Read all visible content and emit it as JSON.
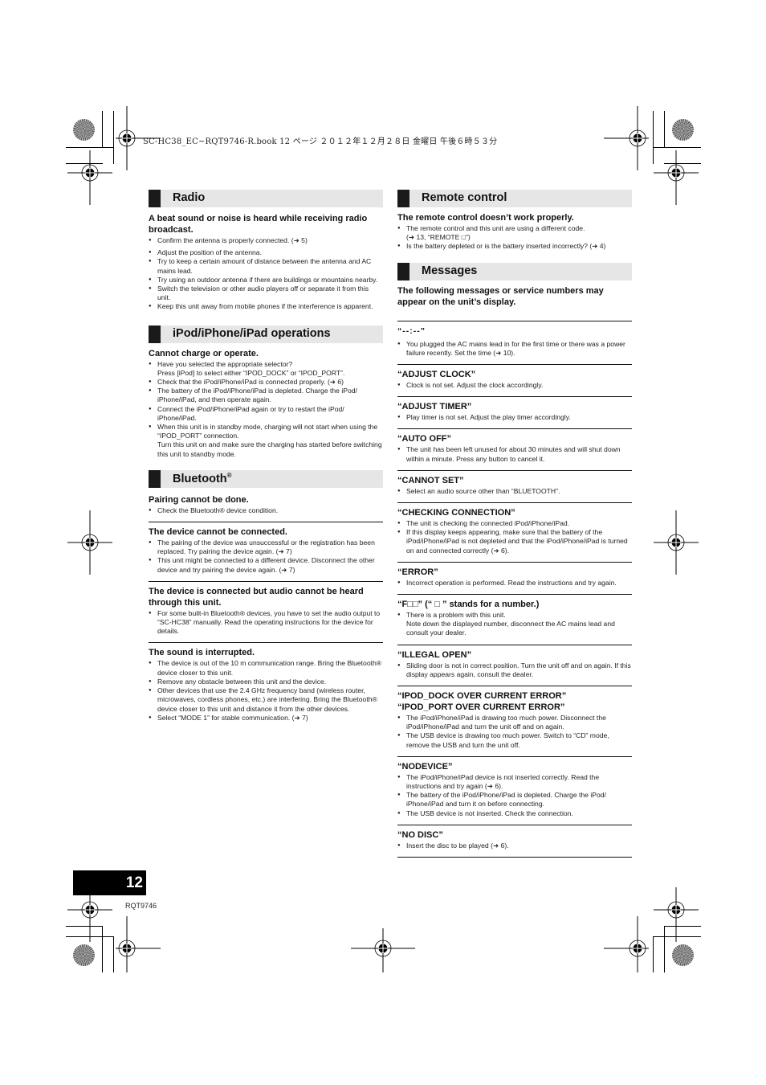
{
  "print_slug": "SC-HC38_EC~RQT9746-R.book  12 ページ  ２０１２年１２月２８日  金曜日  午後６時５３分",
  "left_column": {
    "sections": [
      {
        "title": "Radio",
        "blocks": [
          {
            "question": "A beat sound or noise is heard while receiving radio broadcast.",
            "items": [
              "Confirm the antenna is properly connected. (➜ 5)",
              "Adjust the position of the antenna.",
              "Try to keep a certain amount of distance between the antenna and AC mains lead.",
              "Try using an outdoor antenna if there are buildings or mountains nearby.",
              "Switch the television or other audio players off or separate it from this unit.",
              "Keep this unit away from mobile phones if the interference is apparent."
            ]
          }
        ]
      },
      {
        "title": "iPod/iPhone/iPad operations",
        "blocks": [
          {
            "question": "Cannot charge or operate.",
            "items": [
              "Have you selected the appropriate selector?",
              "Press [iPod] to select either “IPOD_DOCK” or “IPOD_PORT”.",
              "Check that the iPod/iPhone/iPad is connected properly. (➜ 6)",
              "The battery of the iPod/iPhone/iPad is depleted. Charge the iPod/ iPhone/iPad, and then operate again.",
              "Connect the iPod/iPhone/iPad again or try to restart the iPod/ iPhone/iPad.",
              "When this unit is in standby mode, charging will not start when using the “IPOD_PORT” connection.",
              "Turn this unit on and make sure the charging has started before switching this unit to standby mode."
            ]
          }
        ]
      },
      {
        "title": "Bluetooth",
        "title_sup": "®",
        "blocks": [
          {
            "question": "Pairing cannot be done.",
            "items": [
              "Check the Bluetooth® device condition."
            ]
          },
          {
            "question": "The device cannot be connected.",
            "items": [
              "The pairing of the device was unsuccessful or the registration has been replaced. Try pairing the device again. (➜ 7)",
              "This unit might be connected to a different device. Disconnect the other device and try pairing the device again. (➜ 7)"
            ]
          },
          {
            "question": "The device is connected but audio cannot be heard through this unit.",
            "items": [
              "For some built-in Bluetooth® devices, you have to set the audio output to “SC-HC38” manually. Read the operating instructions for the device for details."
            ]
          },
          {
            "question": "The sound is interrupted.",
            "items": [
              "The device is out of the 10 m communication range. Bring the Bluetooth® device closer to this unit.",
              "Remove any obstacle between this unit and the device.",
              "Other devices that use the 2.4 GHz frequency band (wireless router, microwaves, cordless phones, etc.) are interfering. Bring the Bluetooth® device closer to this unit and distance it from the other devices.",
              "Select “MODE 1” for stable communication. (➜ 7)"
            ]
          }
        ]
      }
    ]
  },
  "right_column": {
    "remote": {
      "title": "Remote control",
      "question": "The remote control doesn’t work properly.",
      "items": [
        "The remote control and this unit are using a different code.",
        "(➜ 13, “REMOTE □”)",
        "Is the battery depleted or is the battery inserted incorrectly? (➜ 4)"
      ]
    },
    "messages": {
      "title": "Messages",
      "intro": "The following messages or service numbers may appear on the unit’s display.",
      "entries": [
        {
          "label": "“--:--”",
          "items": [
            "You plugged the AC mains lead in for the first time or there was a power failure recently. Set the time (➜ 10)."
          ]
        },
        {
          "label": "“ADJUST CLOCK”",
          "items": [
            "Clock is not set. Adjust the clock accordingly."
          ]
        },
        {
          "label": "“ADJUST TIMER”",
          "items": [
            "Play timer is not set. Adjust the play timer accordingly."
          ]
        },
        {
          "label": "“AUTO OFF”",
          "items": [
            "The unit has been left unused for about 30 minutes and will shut down within a minute. Press any button to cancel it."
          ]
        },
        {
          "label": "“CANNOT SET”",
          "items": [
            "Select an audio source other than “BLUETOOTH”."
          ]
        },
        {
          "label": "“CHECKING CONNECTION”",
          "items": [
            "The unit is checking the connected iPod/iPhone/iPad.",
            "If this display keeps appearing, make sure that the battery of the iPod/iPhone/iPad is not depleted and that the iPod/iPhone/iPad is turned on and connected correctly (➜ 6)."
          ]
        },
        {
          "label": "“ERROR”",
          "items": [
            "Incorrect operation is performed. Read the instructions and try again."
          ]
        },
        {
          "label": "“F□□” (“ □ ” stands for a number.)",
          "items": [
            "There is a problem with this unit.",
            "Note down the displayed number, disconnect the AC mains lead and consult your dealer."
          ]
        },
        {
          "label": "“ILLEGAL OPEN”",
          "items": [
            "Sliding door is not in correct position. Turn the unit off and on again. If this display appears again, consult the dealer."
          ]
        },
        {
          "label": "“IPOD_DOCK OVER CURRENT ERROR”",
          "label2": "“IPOD_PORT OVER CURRENT ERROR”",
          "items": [
            "The iPod/iPhone/iPad is drawing too much power. Disconnect the iPod/iPhone/iPad and turn the unit off and on again.",
            "The USB device is drawing too much power. Switch to “CD” mode, remove the USB and turn the unit off."
          ]
        },
        {
          "label": "“NODEVICE”",
          "items": [
            "The iPod/iPhone/iPad device is not inserted correctly. Read the instructions and try again (➜ 6).",
            "The battery of the iPod/iPhone/iPad is depleted. Charge the iPod/ iPhone/iPad and turn it on before connecting.",
            "The USB device is not inserted. Check the connection."
          ]
        },
        {
          "label": "“NO DISC”",
          "items": [
            "Insert the disc to be played (➜ 6)."
          ]
        }
      ]
    }
  },
  "footer": {
    "page_number": "12",
    "doc_code": "RQT9746"
  }
}
